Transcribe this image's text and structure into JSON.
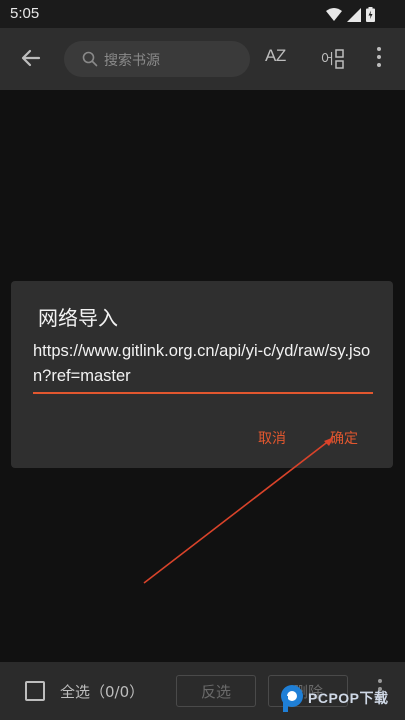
{
  "status_bar": {
    "time": "5:05",
    "icons": [
      "wifi-icon",
      "signal-icon",
      "battery-icon"
    ]
  },
  "app_bar": {
    "back_icon": "arrow-left-icon",
    "search": {
      "placeholder": "搜索书源",
      "icon": "search-icon"
    },
    "sort_label": "AZ",
    "group_icon": "group-icon",
    "more_icon": "more-vertical-icon"
  },
  "dialog": {
    "title": "网络导入",
    "url_value": "https://www.gitlink.org.cn/api/yi-c/yd/raw/sy.json?ref=master",
    "cancel_label": "取消",
    "ok_label": "确定"
  },
  "bottom_bar": {
    "select_all_label": "全选（0/0）",
    "invert_label": "反选",
    "delete_label": "删除",
    "more_icon": "more-vertical-icon"
  },
  "watermark": {
    "text": "PCPOP下载"
  },
  "colors": {
    "accent": "#e2572f",
    "background": "#111111",
    "app_bar": "#2e2e2e",
    "dialog": "#2f2f2f"
  }
}
